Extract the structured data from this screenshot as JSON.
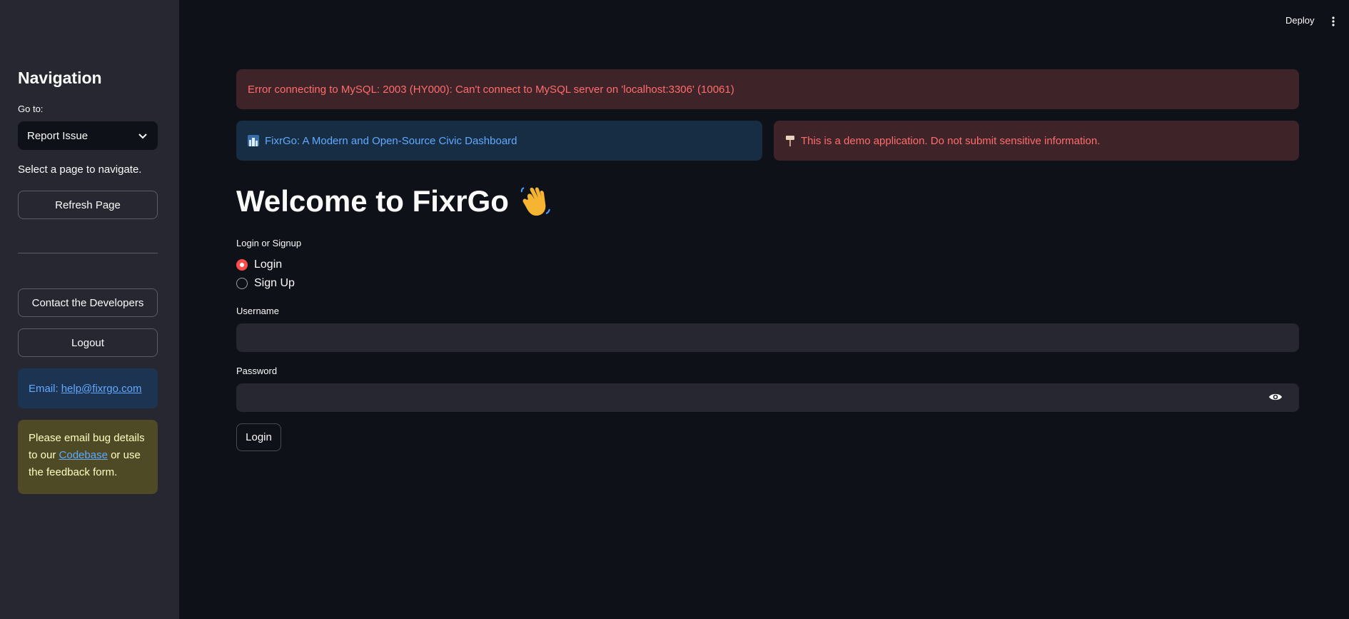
{
  "topbar": {
    "deploy_label": "Deploy",
    "menu_icon": "kebab-menu-icon"
  },
  "sidebar": {
    "title": "Navigation",
    "goto_label": "Go to:",
    "select_value": "Report Issue",
    "hint": "Select a page to navigate.",
    "refresh_label": "Refresh Page",
    "contact_label": "Contact the Developers",
    "logout_label": "Logout",
    "email_prefix": "Email:",
    "email_link": "help@fixrgo.com",
    "bug_text_1": "Please email bug details to our",
    "bug_link": "Codebase",
    "bug_text_2": "or use the feedback form."
  },
  "alerts": {
    "db_error": "Error connecting to MySQL: 2003 (HY000): Can't connect to MySQL server on 'localhost:3306' (10061)",
    "info": "FixrGo: A Modern and Open-Source Civic Dashboard",
    "demo_warning": "This is a demo application. Do not submit sensitive information."
  },
  "main": {
    "welcome": "Welcome to FixrGo",
    "radio_label": "Login or Signup",
    "options": [
      "Login",
      "Sign Up"
    ],
    "selected_option": "Login",
    "username_label": "Username",
    "username_value": "",
    "password_label": "Password",
    "password_value": "",
    "login_button": "Login"
  },
  "colors": {
    "background": "#0e1117",
    "sidebar": "#262730",
    "accent": "#ff4b4b",
    "error_bg": "#3e2428",
    "error_text": "#ff6c6c",
    "info_bg": "#172d43",
    "info_text": "#61a9ff",
    "warning_bg": "#4d4a25",
    "warning_text": "#ffffc2"
  }
}
